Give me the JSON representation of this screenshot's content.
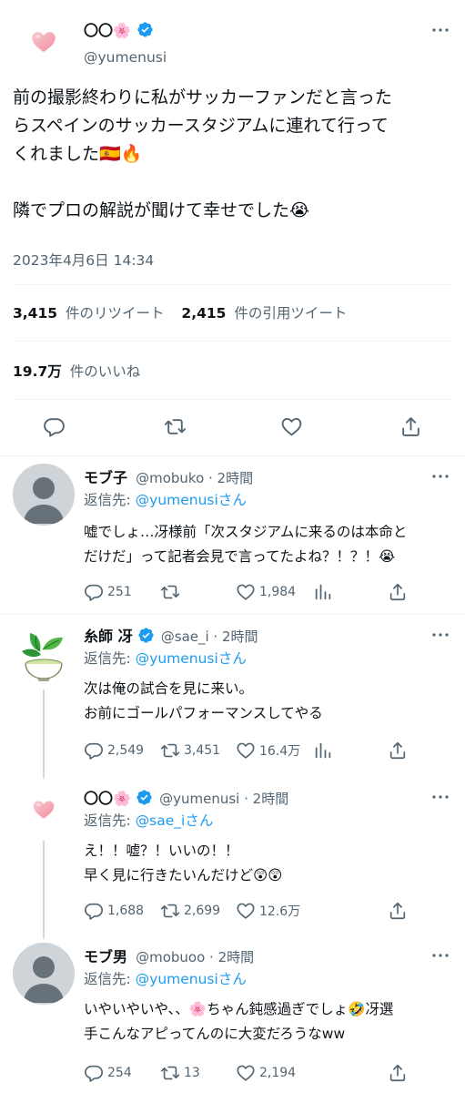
{
  "main_tweet": {
    "display_name": "〇〇🌸",
    "handle": "@yumenusi",
    "text_line1": "前の撮影終わりに私がサッカーファンだと言った",
    "text_line2": "らスペインのサッカースタジアムに連れて行って",
    "text_line3": "くれました🇪🇸🔥",
    "text_line4": "隣でプロの解説が聞けて幸せでした😭",
    "timestamp": "2023年4月6日 14:34",
    "retweets_count": "3,415",
    "retweets_label": "件のリツイート",
    "quotes_count": "2,415",
    "quotes_label": "件の引用ツイート",
    "likes_count": "19.7万",
    "likes_label": "件のいいね"
  },
  "replies": [
    {
      "display_name": "モブ子",
      "handle_time": "@mobuko · 2時間",
      "reply_label": "返信先: ",
      "reply_target": "@yumenusiさん",
      "text_line1": "嘘でしょ…冴様前「次スタジアムに来るのは本命と",
      "text_line2": "だけだ」って記者会見で言ってたよね？！？！😭",
      "reply_count": "251",
      "retweet_count": "",
      "like_count": "1,984"
    },
    {
      "display_name": "糸師 冴",
      "handle_time": "@sae_i · 2時間",
      "reply_label": "返信先: ",
      "reply_target": "@yumenusiさん",
      "text_line1": "次は俺の試合を見に来い。",
      "text_line2": "お前にゴールパフォーマンスしてやる",
      "reply_count": "2,549",
      "retweet_count": "3,451",
      "like_count": "16.4万"
    },
    {
      "display_name": "〇〇🌸",
      "handle_time": "@yumenusi · 2時間",
      "reply_label": "返信先: ",
      "reply_target": "@sae_iさん",
      "text_line1": "え！！嘘？！いいの！！",
      "text_line2": "早く見に行きたいんだけど😲😲",
      "reply_count": "1,688",
      "retweet_count": "2,699",
      "like_count": "12.6万"
    },
    {
      "display_name": "モブ男",
      "handle_time": "@mobuoo · 2時間",
      "reply_label": "返信先: ",
      "reply_target": "@yumenusiさん",
      "text_line1": "いやいやいや、、🌸ちゃん鈍感過ぎでしょ🤣冴選",
      "text_line2": "手こんなアピってんのに大変だろうなww",
      "reply_count": "254",
      "retweet_count": "13",
      "like_count": "2,194"
    }
  ],
  "colors": {
    "accent": "#1d9bf0",
    "text": "#0f1419",
    "muted": "#536471",
    "divider": "#eff3f4"
  },
  "icons": [
    "heart-avatar-icon",
    "verified-badge-icon",
    "more-dots-icon",
    "reply-icon",
    "retweet-icon",
    "like-icon",
    "share-icon",
    "analytics-icon",
    "tea-leaf-avatar-icon",
    "default-avatar-icon"
  ]
}
